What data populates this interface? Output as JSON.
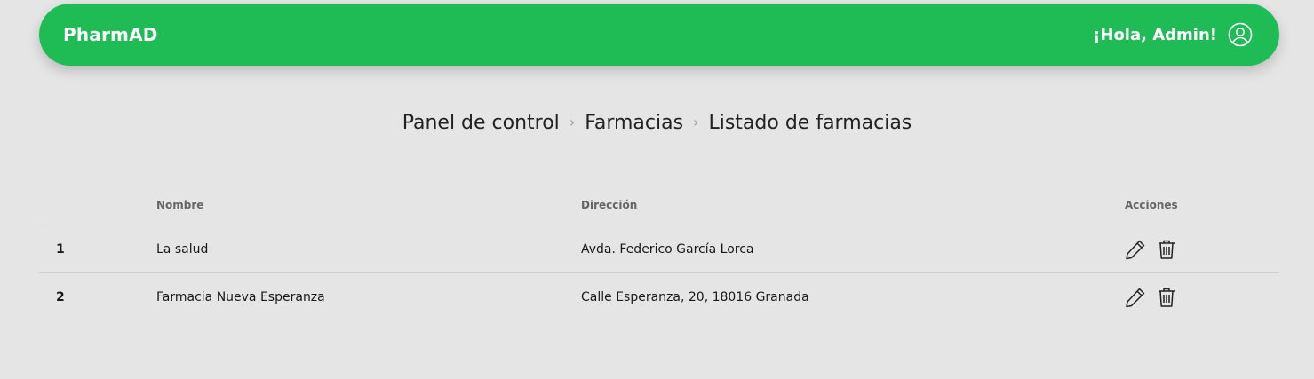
{
  "navbar": {
    "brand": "PharmAD",
    "greeting": "¡Hola, Admin!",
    "user_icon": "user-circle-icon"
  },
  "breadcrumb": {
    "items": [
      "Panel de control",
      "Farmacias",
      "Listado de farmacias"
    ],
    "separator_icon": "chevron-right-icon"
  },
  "table": {
    "headers": {
      "index": "",
      "name": "Nombre",
      "address": "Dirección",
      "actions": "Acciones"
    },
    "rows": [
      {
        "index": "1",
        "name": "La salud",
        "address": "Avda. Federico García Lorca"
      },
      {
        "index": "2",
        "name": "Farmacia Nueva Esperanza",
        "address": "Calle Esperanza, 20, 18016 Granada"
      }
    ],
    "action_icons": [
      "pencil-icon",
      "trash-icon"
    ]
  },
  "colors": {
    "brand_green": "#1fbb55",
    "background": "#e5e5e5"
  }
}
